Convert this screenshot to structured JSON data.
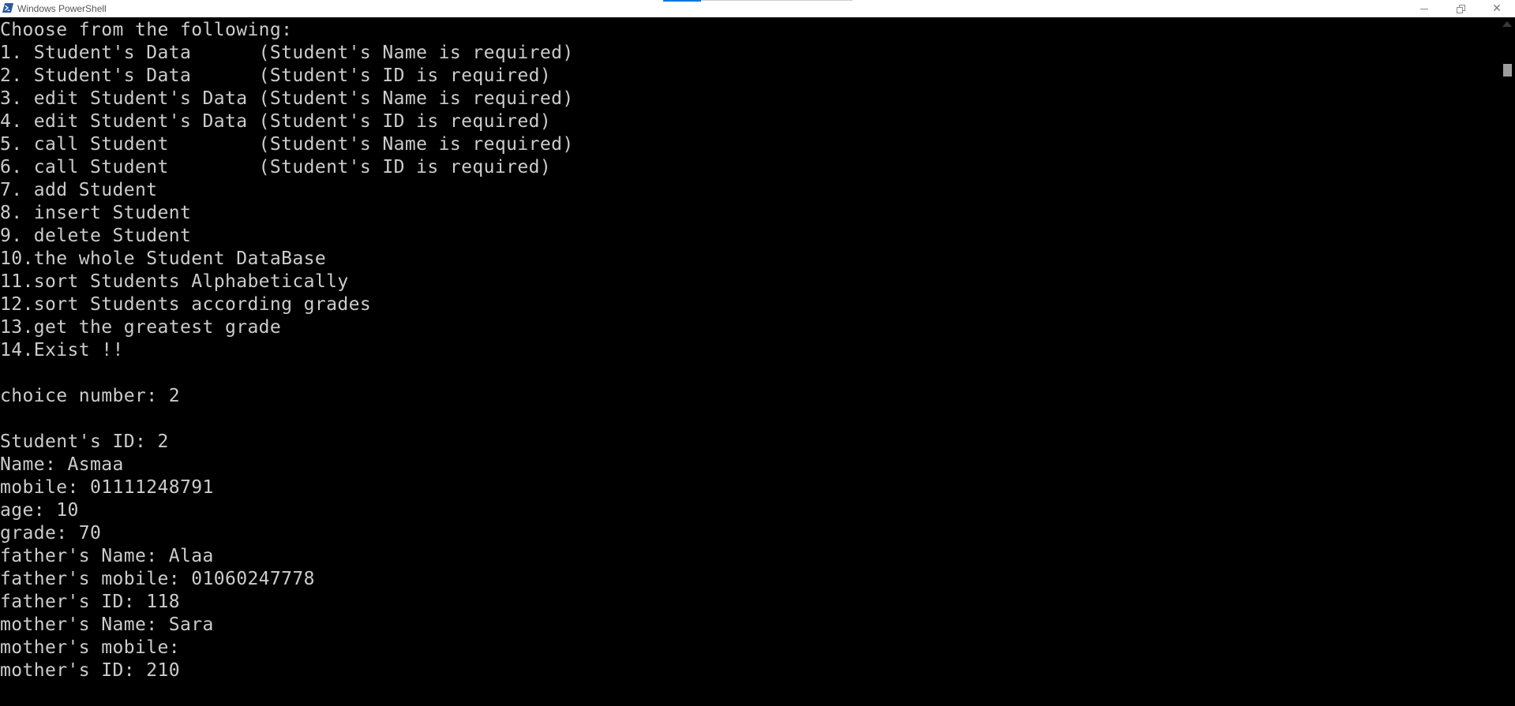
{
  "window": {
    "title": "Windows PowerShell",
    "icon": "powershell-icon",
    "controls": {
      "minimize": "minimize-icon",
      "restore": "restore-icon",
      "close": "close-icon"
    },
    "accent_color": "#0078d7"
  },
  "console": {
    "foreground": "#cccccc",
    "background": "#000000",
    "lines": [
      "Choose from the following:",
      "1. Student's Data      (Student's Name is required)",
      "2. Student's Data      (Student's ID is required)",
      "3. edit Student's Data (Student's Name is required)",
      "4. edit Student's Data (Student's ID is required)",
      "5. call Student        (Student's Name is required)",
      "6. call Student        (Student's ID is required)",
      "7. add Student",
      "8. insert Student",
      "9. delete Student",
      "10.the whole Student DataBase",
      "11.sort Students Alphabetically",
      "12.sort Students according grades",
      "13.get the greatest grade",
      "14.Exist !!",
      "",
      "choice number: 2",
      "",
      "Student's ID: 2",
      "Name: Asmaa",
      "mobile: 01111248791",
      "age: 10",
      "grade: 70",
      "father's Name: Alaa",
      "father's mobile: 01060247778",
      "father's ID: 118",
      "mother's Name: Sara",
      "mother's mobile:",
      "mother's ID: 210"
    ]
  }
}
